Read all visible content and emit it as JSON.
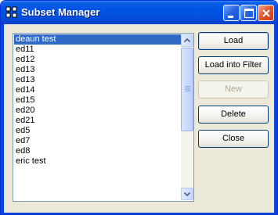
{
  "window": {
    "title": "Subset Manager"
  },
  "subsets": {
    "items": [
      {
        "label": "deaun test",
        "selected": true
      },
      {
        "label": "ed11",
        "selected": false
      },
      {
        "label": "ed12",
        "selected": false
      },
      {
        "label": "ed13",
        "selected": false
      },
      {
        "label": "ed13",
        "selected": false
      },
      {
        "label": "ed14",
        "selected": false
      },
      {
        "label": "ed15",
        "selected": false
      },
      {
        "label": "ed20",
        "selected": false
      },
      {
        "label": "ed21",
        "selected": false
      },
      {
        "label": "ed5",
        "selected": false
      },
      {
        "label": "ed7",
        "selected": false
      },
      {
        "label": "ed8",
        "selected": false
      },
      {
        "label": "eric test",
        "selected": false
      }
    ]
  },
  "buttons": {
    "load": "Load",
    "load_into_filter": "Load into Filter",
    "new": "New",
    "delete": "Delete",
    "close": "Close"
  },
  "button_states": {
    "new_enabled": false
  },
  "colors": {
    "titlebar": "#0054e3",
    "selection": "#316ac5",
    "dialog_bg": "#ece9d8"
  }
}
